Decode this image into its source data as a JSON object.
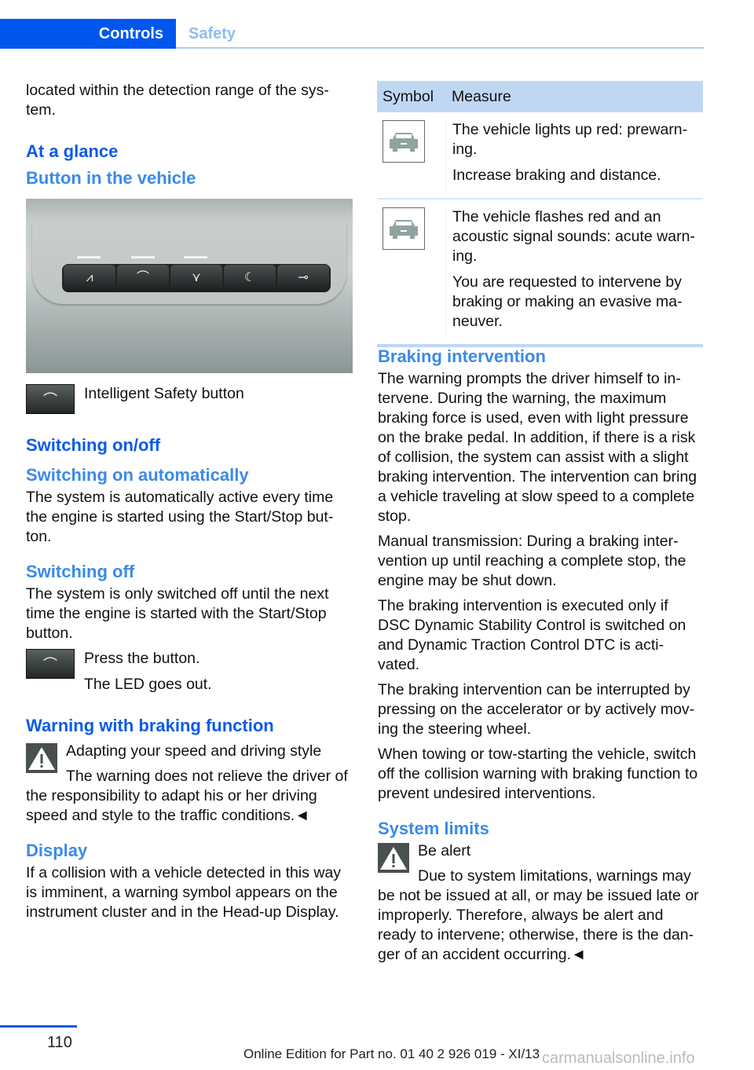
{
  "header": {
    "tabs": [
      {
        "label": "Controls",
        "active": true
      },
      {
        "label": "Safety",
        "active": false
      }
    ]
  },
  "left": {
    "intro": "located within the detection range of the sys-tem.",
    "at_a_glance": "At a glance",
    "button_in_vehicle": "Button in the vehicle",
    "photo_buttons": [
      "lane-departure",
      "collision-warning",
      "pedestrian-warning",
      "night-vision",
      "park-assist"
    ],
    "intelligent_safety_label": "Intelligent Safety button",
    "switching_onoff": "Switching on/off",
    "switching_on_auto": "Switching on automatically",
    "switching_on_auto_text": "The system is automatically active every time the engine is started using the Start/Stop but-ton.",
    "switching_off": "Switching off",
    "switching_off_text": "The system is only switched off until the next time the engine is started with the Start/Stop button.",
    "press_button": "Press the button.",
    "led_out": "The LED goes out.",
    "warning_braking": "Warning with braking function",
    "warn_title": "Adapting your speed and driving style",
    "warn_text": "The warning does not relieve the driver of the responsibility to adapt his or her driving speed and style to the traffic conditions.◄",
    "display": "Display",
    "display_text": "If a collision with a vehicle detected in this way is imminent, a warning symbol appears on the instrument cluster and in the Head-up Display."
  },
  "table": {
    "headers": [
      "Symbol",
      "Measure"
    ],
    "rows": [
      {
        "icon": "car-front-icon",
        "lines": [
          "The vehicle lights up red: prewarn-ing.",
          "Increase braking and distance."
        ]
      },
      {
        "icon": "car-front-icon",
        "lines": [
          "The vehicle flashes red and an acoustic signal sounds: acute warn-ing.",
          "You are requested to intervene by braking or making an evasive ma-neuver."
        ]
      }
    ]
  },
  "right": {
    "braking_intervention": "Braking intervention",
    "p1": "The warning prompts the driver himself to in-tervene. During the warning, the maximum braking force is used, even with light pressure on the brake pedal. In addition, if there is a risk of collision, the system can assist with a slight braking intervention. The intervention can bring a vehicle traveling at slow speed to a complete stop.",
    "p2": "Manual transmission: During a braking inter-vention up until reaching a complete stop, the engine may be shut down.",
    "p3": "The braking intervention is executed only if DSC Dynamic Stability Control is switched on and Dynamic Traction Control DTC is acti-vated.",
    "p4": "The braking intervention can be interrupted by pressing on the accelerator or by actively mov-ing the steering wheel.",
    "p5": "When towing or tow-starting the vehicle, switch off the collision warning with braking function to prevent undesired interventions.",
    "system_limits": "System limits",
    "alert_title": "Be alert",
    "alert_text": "Due to system limitations, warnings may be not be issued at all, or may be issued late or improperly. Therefore, always be alert and ready to intervene; otherwise, there is the dan-ger of an accident occurring.◄"
  },
  "footer": {
    "page": "110",
    "edition": "Online Edition for Part no. 01 40 2 926 019 - XI/13",
    "watermark": "carmanualsonline.info"
  }
}
